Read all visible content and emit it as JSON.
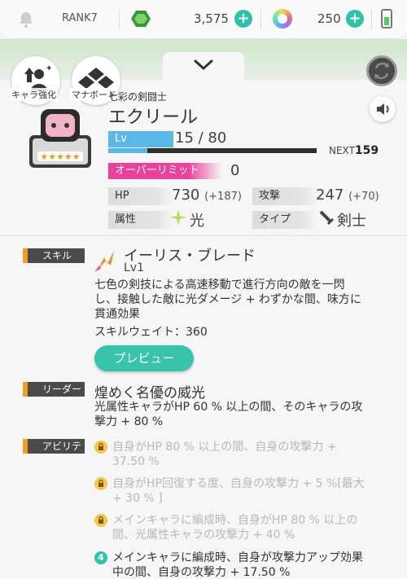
{
  "header": {
    "rank": "RANK7",
    "gems": "3,575",
    "orbs": "250"
  },
  "menu": {
    "enhance_label": "キャラ強化",
    "manaboard_label": "マナボード"
  },
  "character": {
    "title": "七彩の剣闘士",
    "name": "エクリール",
    "lv_label": "Lv",
    "level": "15 / 80",
    "level_fraction": 0.1875,
    "next_label": "NEXT",
    "next_value": "159",
    "overlimit_label": "オーバーリミット",
    "overlimit_value": "0",
    "hp_label": "HP",
    "hp_value": "730",
    "hp_bonus": "(+187)",
    "atk_label": "攻撃",
    "atk_value": "247",
    "atk_bonus": "(+70)",
    "element_label": "属性",
    "element_value": "光",
    "type_label": "タイプ",
    "type_value": "剣士"
  },
  "skill": {
    "section_label": "スキル",
    "name": "イーリス・ブレード",
    "level": "Lv1",
    "desc_lines": [
      "七色の剣技による高速移動で進行方向の敵を一閃",
      "し、接触した敵に光ダメージ + わずかな間、味方に",
      "貫通効果"
    ],
    "weight": "スキルウェイト：360",
    "preview_label": "プレビュー"
  },
  "leader": {
    "section_label": "リーダー",
    "name": "煌めく名優の威光",
    "desc_lines": [
      "光属性キャラがHP 60 % 以上の間、そのキャラの攻",
      "撃力 + 80 %"
    ]
  },
  "ability": {
    "section_label": "アビリティ",
    "items": [
      {
        "lines": [
          "自身がHP 80 % 以上の間、自身の攻撃力 +",
          "37.50 %"
        ]
      },
      {
        "lines": [
          "自身がHP回復する度、自身の攻撃力 + 5 %[最大",
          "+ 30 % ]"
        ]
      },
      {
        "lines": [
          "メインキャラに編成時、自身がHP 80 % 以上の",
          "間、光属性キャラの攻撃力 + 40 %"
        ]
      },
      {
        "badge": "4",
        "lines": [
          "メインキャラに編成時、自身が攻撃力アップ効果",
          "中の間、自身の攻撃力 + 17.50 %"
        ]
      }
    ]
  },
  "colors": {
    "accent_teal": "#37c3ac",
    "lv_blue": "#5bb7e6",
    "overlimit_pink": "#e9429a",
    "section_orange": "#f0a020"
  }
}
